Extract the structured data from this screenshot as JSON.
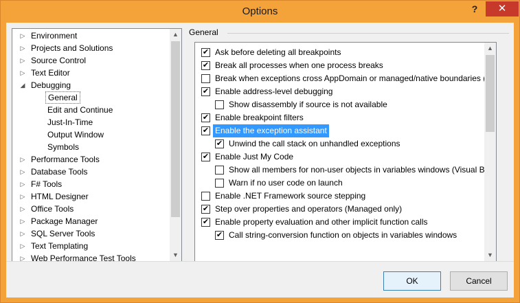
{
  "window": {
    "title": "Options",
    "help_label": "?",
    "close_label": "✕"
  },
  "tree": {
    "items": [
      {
        "label": "Environment",
        "arrow": "▷"
      },
      {
        "label": "Projects and Solutions",
        "arrow": "▷"
      },
      {
        "label": "Source Control",
        "arrow": "▷"
      },
      {
        "label": "Text Editor",
        "arrow": "▷"
      },
      {
        "label": "Debugging",
        "arrow": "◢"
      },
      {
        "label": "General",
        "arrow": ""
      },
      {
        "label": "Edit and Continue",
        "arrow": ""
      },
      {
        "label": "Just-In-Time",
        "arrow": ""
      },
      {
        "label": "Output Window",
        "arrow": ""
      },
      {
        "label": "Symbols",
        "arrow": ""
      },
      {
        "label": "Performance Tools",
        "arrow": "▷"
      },
      {
        "label": "Database Tools",
        "arrow": "▷"
      },
      {
        "label": "F# Tools",
        "arrow": "▷"
      },
      {
        "label": "HTML Designer",
        "arrow": "▷"
      },
      {
        "label": "Office Tools",
        "arrow": "▷"
      },
      {
        "label": "Package Manager",
        "arrow": "▷"
      },
      {
        "label": "SQL Server Tools",
        "arrow": "▷"
      },
      {
        "label": "Text Templating",
        "arrow": "▷"
      },
      {
        "label": "Web Performance Test Tools",
        "arrow": "▷"
      }
    ],
    "selected": "General"
  },
  "section_title": "General",
  "options": [
    {
      "label": "Ask before deleting all breakpoints",
      "checked": true
    },
    {
      "label": "Break all processes when one process breaks",
      "checked": true
    },
    {
      "label": "Break when exceptions cross AppDomain or managed/native boundaries (M",
      "checked": false
    },
    {
      "label": "Enable address-level debugging",
      "checked": true
    },
    {
      "label": "Show disassembly if source is not available",
      "checked": false
    },
    {
      "label": "Enable breakpoint filters",
      "checked": true
    },
    {
      "label": "Enable the exception assistant",
      "checked": true
    },
    {
      "label": "Unwind the call stack on unhandled exceptions",
      "checked": true
    },
    {
      "label": "Enable Just My Code",
      "checked": true
    },
    {
      "label": "Show all members for non-user objects in variables windows (Visual Ba",
      "checked": false
    },
    {
      "label": "Warn if no user code on launch",
      "checked": false
    },
    {
      "label": "Enable .NET Framework source stepping",
      "checked": false
    },
    {
      "label": "Step over properties and operators (Managed only)",
      "checked": true
    },
    {
      "label": "Enable property evaluation and other implicit function calls",
      "checked": true
    },
    {
      "label": "Call string-conversion function on objects in variables windows",
      "checked": true
    }
  ],
  "selected_option": "Enable the exception assistant",
  "buttons": {
    "ok": "OK",
    "cancel": "Cancel"
  },
  "scroll": {
    "up": "▲",
    "down": "▼"
  },
  "colors": {
    "titlebar": "#f4a23a",
    "close": "#c7392b",
    "selection": "#3399ff"
  }
}
